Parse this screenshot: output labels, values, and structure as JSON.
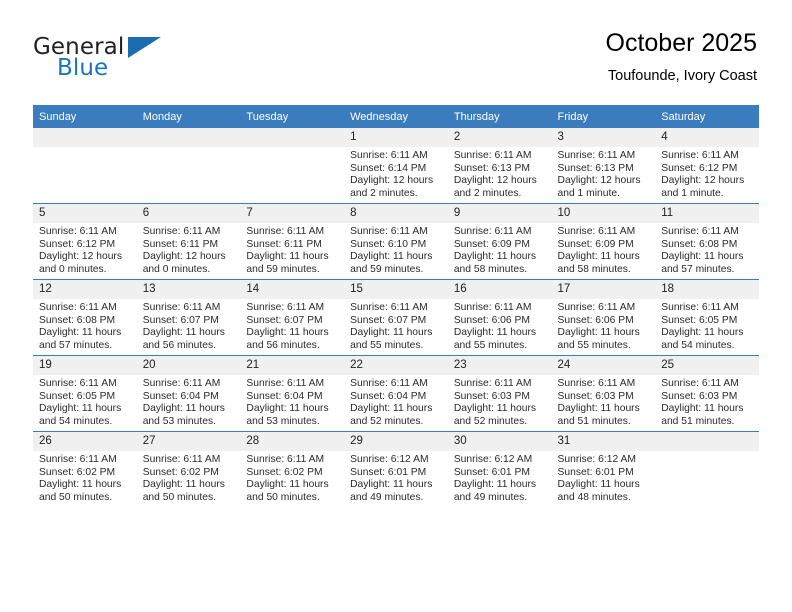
{
  "brand": {
    "name_part1": "General",
    "name_part2": "Blue",
    "flag_icon": "triangle-flag-icon",
    "accent_color": "#1b75bb"
  },
  "header": {
    "title": "October 2025",
    "subtitle": "Toufounde, Ivory Coast"
  },
  "calendar": {
    "header_bg": "#3b7cbf",
    "daynum_bg": "#f0f0f0",
    "weekday_headers": [
      "Sunday",
      "Monday",
      "Tuesday",
      "Wednesday",
      "Thursday",
      "Friday",
      "Saturday"
    ],
    "weeks": [
      [
        {
          "day": "",
          "empty": true,
          "sunrise": "",
          "sunset": "",
          "daylight1": "",
          "daylight2": ""
        },
        {
          "day": "",
          "empty": true,
          "sunrise": "",
          "sunset": "",
          "daylight1": "",
          "daylight2": ""
        },
        {
          "day": "",
          "empty": true,
          "sunrise": "",
          "sunset": "",
          "daylight1": "",
          "daylight2": ""
        },
        {
          "day": "1",
          "empty": false,
          "sunrise": "Sunrise: 6:11 AM",
          "sunset": "Sunset: 6:14 PM",
          "daylight1": "Daylight: 12 hours",
          "daylight2": "and 2 minutes."
        },
        {
          "day": "2",
          "empty": false,
          "sunrise": "Sunrise: 6:11 AM",
          "sunset": "Sunset: 6:13 PM",
          "daylight1": "Daylight: 12 hours",
          "daylight2": "and 2 minutes."
        },
        {
          "day": "3",
          "empty": false,
          "sunrise": "Sunrise: 6:11 AM",
          "sunset": "Sunset: 6:13 PM",
          "daylight1": "Daylight: 12 hours",
          "daylight2": "and 1 minute."
        },
        {
          "day": "4",
          "empty": false,
          "sunrise": "Sunrise: 6:11 AM",
          "sunset": "Sunset: 6:12 PM",
          "daylight1": "Daylight: 12 hours",
          "daylight2": "and 1 minute."
        }
      ],
      [
        {
          "day": "5",
          "empty": false,
          "sunrise": "Sunrise: 6:11 AM",
          "sunset": "Sunset: 6:12 PM",
          "daylight1": "Daylight: 12 hours",
          "daylight2": "and 0 minutes."
        },
        {
          "day": "6",
          "empty": false,
          "sunrise": "Sunrise: 6:11 AM",
          "sunset": "Sunset: 6:11 PM",
          "daylight1": "Daylight: 12 hours",
          "daylight2": "and 0 minutes."
        },
        {
          "day": "7",
          "empty": false,
          "sunrise": "Sunrise: 6:11 AM",
          "sunset": "Sunset: 6:11 PM",
          "daylight1": "Daylight: 11 hours",
          "daylight2": "and 59 minutes."
        },
        {
          "day": "8",
          "empty": false,
          "sunrise": "Sunrise: 6:11 AM",
          "sunset": "Sunset: 6:10 PM",
          "daylight1": "Daylight: 11 hours",
          "daylight2": "and 59 minutes."
        },
        {
          "day": "9",
          "empty": false,
          "sunrise": "Sunrise: 6:11 AM",
          "sunset": "Sunset: 6:09 PM",
          "daylight1": "Daylight: 11 hours",
          "daylight2": "and 58 minutes."
        },
        {
          "day": "10",
          "empty": false,
          "sunrise": "Sunrise: 6:11 AM",
          "sunset": "Sunset: 6:09 PM",
          "daylight1": "Daylight: 11 hours",
          "daylight2": "and 58 minutes."
        },
        {
          "day": "11",
          "empty": false,
          "sunrise": "Sunrise: 6:11 AM",
          "sunset": "Sunset: 6:08 PM",
          "daylight1": "Daylight: 11 hours",
          "daylight2": "and 57 minutes."
        }
      ],
      [
        {
          "day": "12",
          "empty": false,
          "sunrise": "Sunrise: 6:11 AM",
          "sunset": "Sunset: 6:08 PM",
          "daylight1": "Daylight: 11 hours",
          "daylight2": "and 57 minutes."
        },
        {
          "day": "13",
          "empty": false,
          "sunrise": "Sunrise: 6:11 AM",
          "sunset": "Sunset: 6:07 PM",
          "daylight1": "Daylight: 11 hours",
          "daylight2": "and 56 minutes."
        },
        {
          "day": "14",
          "empty": false,
          "sunrise": "Sunrise: 6:11 AM",
          "sunset": "Sunset: 6:07 PM",
          "daylight1": "Daylight: 11 hours",
          "daylight2": "and 56 minutes."
        },
        {
          "day": "15",
          "empty": false,
          "sunrise": "Sunrise: 6:11 AM",
          "sunset": "Sunset: 6:07 PM",
          "daylight1": "Daylight: 11 hours",
          "daylight2": "and 55 minutes."
        },
        {
          "day": "16",
          "empty": false,
          "sunrise": "Sunrise: 6:11 AM",
          "sunset": "Sunset: 6:06 PM",
          "daylight1": "Daylight: 11 hours",
          "daylight2": "and 55 minutes."
        },
        {
          "day": "17",
          "empty": false,
          "sunrise": "Sunrise: 6:11 AM",
          "sunset": "Sunset: 6:06 PM",
          "daylight1": "Daylight: 11 hours",
          "daylight2": "and 55 minutes."
        },
        {
          "day": "18",
          "empty": false,
          "sunrise": "Sunrise: 6:11 AM",
          "sunset": "Sunset: 6:05 PM",
          "daylight1": "Daylight: 11 hours",
          "daylight2": "and 54 minutes."
        }
      ],
      [
        {
          "day": "19",
          "empty": false,
          "sunrise": "Sunrise: 6:11 AM",
          "sunset": "Sunset: 6:05 PM",
          "daylight1": "Daylight: 11 hours",
          "daylight2": "and 54 minutes."
        },
        {
          "day": "20",
          "empty": false,
          "sunrise": "Sunrise: 6:11 AM",
          "sunset": "Sunset: 6:04 PM",
          "daylight1": "Daylight: 11 hours",
          "daylight2": "and 53 minutes."
        },
        {
          "day": "21",
          "empty": false,
          "sunrise": "Sunrise: 6:11 AM",
          "sunset": "Sunset: 6:04 PM",
          "daylight1": "Daylight: 11 hours",
          "daylight2": "and 53 minutes."
        },
        {
          "day": "22",
          "empty": false,
          "sunrise": "Sunrise: 6:11 AM",
          "sunset": "Sunset: 6:04 PM",
          "daylight1": "Daylight: 11 hours",
          "daylight2": "and 52 minutes."
        },
        {
          "day": "23",
          "empty": false,
          "sunrise": "Sunrise: 6:11 AM",
          "sunset": "Sunset: 6:03 PM",
          "daylight1": "Daylight: 11 hours",
          "daylight2": "and 52 minutes."
        },
        {
          "day": "24",
          "empty": false,
          "sunrise": "Sunrise: 6:11 AM",
          "sunset": "Sunset: 6:03 PM",
          "daylight1": "Daylight: 11 hours",
          "daylight2": "and 51 minutes."
        },
        {
          "day": "25",
          "empty": false,
          "sunrise": "Sunrise: 6:11 AM",
          "sunset": "Sunset: 6:03 PM",
          "daylight1": "Daylight: 11 hours",
          "daylight2": "and 51 minutes."
        }
      ],
      [
        {
          "day": "26",
          "empty": false,
          "sunrise": "Sunrise: 6:11 AM",
          "sunset": "Sunset: 6:02 PM",
          "daylight1": "Daylight: 11 hours",
          "daylight2": "and 50 minutes."
        },
        {
          "day": "27",
          "empty": false,
          "sunrise": "Sunrise: 6:11 AM",
          "sunset": "Sunset: 6:02 PM",
          "daylight1": "Daylight: 11 hours",
          "daylight2": "and 50 minutes."
        },
        {
          "day": "28",
          "empty": false,
          "sunrise": "Sunrise: 6:11 AM",
          "sunset": "Sunset: 6:02 PM",
          "daylight1": "Daylight: 11 hours",
          "daylight2": "and 50 minutes."
        },
        {
          "day": "29",
          "empty": false,
          "sunrise": "Sunrise: 6:12 AM",
          "sunset": "Sunset: 6:01 PM",
          "daylight1": "Daylight: 11 hours",
          "daylight2": "and 49 minutes."
        },
        {
          "day": "30",
          "empty": false,
          "sunrise": "Sunrise: 6:12 AM",
          "sunset": "Sunset: 6:01 PM",
          "daylight1": "Daylight: 11 hours",
          "daylight2": "and 49 minutes."
        },
        {
          "day": "31",
          "empty": false,
          "sunrise": "Sunrise: 6:12 AM",
          "sunset": "Sunset: 6:01 PM",
          "daylight1": "Daylight: 11 hours",
          "daylight2": "and 48 minutes."
        },
        {
          "day": "",
          "empty": true,
          "sunrise": "",
          "sunset": "",
          "daylight1": "",
          "daylight2": ""
        }
      ]
    ]
  }
}
